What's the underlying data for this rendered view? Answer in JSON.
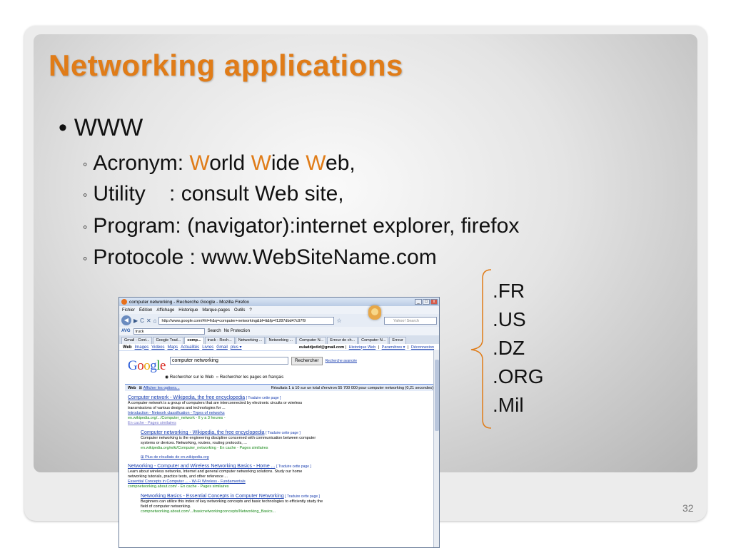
{
  "slide": {
    "title": "Networking applications",
    "bullet_main": "WWW",
    "items": {
      "acronym": {
        "label": "Acronym: ",
        "w1": "W",
        "orld": "orld ",
        "w2": "W",
        "ide": "ide ",
        "w3": "W",
        "eb": "eb,"
      },
      "utility": "Utility    : consult Web site,",
      "program": "Program: (navigator):internet explorer, firefox",
      "protocole": "Protocole : www.WebSiteName.com"
    },
    "tlds": [
      ".FR",
      ".US",
      ".DZ",
      ".ORG",
      ".Mil"
    ],
    "page_number": "32"
  },
  "browser": {
    "window_title": "computer networking - Recherche Google - Mozilla Firefox",
    "menu": [
      "Fichier",
      "Édition",
      "Affichage",
      "Historique",
      "Marque-pages",
      "Outils",
      "?"
    ],
    "url": "http://www.google.com/#hl=fr&q=computer+networking&bl=tt&fp=f1287dbd47c97f9",
    "search_placeholder": "Yahoo! Search",
    "avg": {
      "label": "AVG",
      "input": "truck",
      "search": "Search",
      "no_protection": "No Protection"
    },
    "tabs": [
      "Gmail - Cont...",
      "Google Trad...",
      "comp...",
      "truck - Rech...",
      "Networking ...",
      "Networking ...",
      "Computer N...",
      "Erreur de ch...",
      "Computer N...",
      "Erreur"
    ],
    "google_topbar": {
      "links": [
        "Web",
        "Images",
        "Vidéos",
        "Maps",
        "Actualités",
        "Livres",
        "Gmail",
        "plus ▾"
      ],
      "account": "ouladdjedid@gmail.com",
      "right_links": [
        "Historique Web",
        "Paramètres ▾",
        "Déconnexion"
      ]
    },
    "search_query": "computer networking",
    "search_button": "Rechercher",
    "advanced_search": "Recherche avancée",
    "radio_web": "Rechercher sur le Web",
    "radio_fr": "Rechercher les pages en français",
    "resultbar": {
      "web": "Web",
      "options": "Afficher les options...",
      "count": "Résultats 1 à 10 sur un total d'environ 55 700 000 pour computer networking (0,21 secondes)"
    },
    "results": [
      {
        "title": "Computer network - Wikipedia, the free encyclopedia",
        "translate": "[ Traduire cette page ]",
        "snippet": "A computer network is a group of computers that are interconnected by electronic circuits or wireless transmissions of various designs and technologies for ...",
        "links": "Introduction - Network classification - Types of networks",
        "url": "en.wikipedia.org/.../Computer_network - Il y a 3 heures -",
        "cache": "En cache - Pages similaires"
      },
      {
        "title": "Computer networking - Wikipedia, the free encyclopedia",
        "translate": "[ Traduire cette page ]",
        "snippet": "Computer networking is the engineering discipline concerned with communication between computer systems or devices. Networking, routers, routing protocols, ...",
        "url": "en.wikipedia.org/wiki/Computer_networking - En cache - Pages similaires"
      },
      {
        "title": "Networking - Computer and Wireless Networking Basics - Home ...",
        "translate": "[ Traduire cette page ]",
        "snippet": "Learn about wireless networks, Internet and general computer networking solutions. Study our home networking tutorials, practice tests, and other reference ...",
        "links": "Essential Concepts in Computer ... - Wi-Fi Wireless - Fundamentals",
        "url": "compnetworking.about.com/ - En cache - Pages similaires"
      },
      {
        "title": "Networking Basics - Essential Concepts in Computer Networking",
        "translate": "[ Traduire cette page ]",
        "snippet": "Beginners can utilize this index of key networking concepts and basic technologies to efficiently study the field of computer networking.",
        "url": "compnetworking.about.com/.../basicnetworkingconcepts/Networking_Basics..."
      }
    ],
    "more_results": "Plus de résultats de en.wikipedia.org"
  }
}
